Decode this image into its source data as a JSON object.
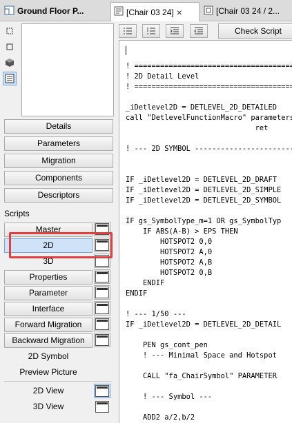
{
  "tabs": [
    {
      "label": "Ground Floor P...",
      "icon": "floorplan-icon"
    },
    {
      "label": "[Chair 03 24]",
      "icon": "object-script-icon",
      "close": "×"
    },
    {
      "label": "[Chair 03 24 / 2...",
      "icon": "object-view-icon"
    }
  ],
  "nav_buttons": [
    "Details",
    "Parameters",
    "Migration",
    "Components",
    "Descriptors"
  ],
  "scripts_heading": "Scripts",
  "scripts": [
    {
      "label": "Master",
      "selected": false
    },
    {
      "label": "2D",
      "selected": true
    },
    {
      "label": "3D",
      "selected": false
    },
    {
      "label": "Properties",
      "selected": false
    },
    {
      "label": "Parameter",
      "selected": false
    },
    {
      "label": "Interface",
      "selected": false
    },
    {
      "label": "Forward Migration",
      "selected": false
    },
    {
      "label": "Backward Migration",
      "selected": false
    }
  ],
  "extra_items": [
    "2D Symbol",
    "Preview Picture"
  ],
  "views": [
    {
      "label": "2D View",
      "active": true
    },
    {
      "label": "3D View",
      "active": false
    }
  ],
  "toolbar": {
    "check_label": "Check Script"
  },
  "code_lines": [
    "",
    "",
    "! ==================================================",
    "! 2D Detail Level",
    "! ==================================================",
    "",
    "_iDetlevel2D = DETLEVEL_2D_DETAILED",
    "call \"DetlevelFunctionMacro\" parameters",
    "                              ret",
    "",
    "! --- 2D SYMBOL --------------------------------",
    "",
    "",
    "IF _iDetlevel2D = DETLEVEL_2D_DRAFT",
    "IF _iDetlevel2D = DETLEVEL_2D_SIMPLE",
    "IF _iDetlevel2D = DETLEVEL_2D_SYMBOL",
    "",
    "IF gs_SymbolType_m=1 OR gs_SymbolTyp",
    "    IF ABS(A-B) > EPS THEN",
    "        HOTSPOT2 0,0",
    "        HOTSPOT2 A,0",
    "        HOTSPOT2 A,B",
    "        HOTSPOT2 0,B",
    "    ENDIF",
    "ENDIF",
    "",
    "! --- 1/50 ---",
    "IF _iDetlevel2D = DETLEVEL_2D_DETAIL",
    "",
    "    PEN gs_cont_pen",
    "    ! --- Minimal Space and Hotspot",
    "",
    "    CALL \"fa_ChairSymbol\" PARAMETER",
    "",
    "    ! --- Symbol ---",
    "",
    "    ADD2 a/2,b/2"
  ]
}
